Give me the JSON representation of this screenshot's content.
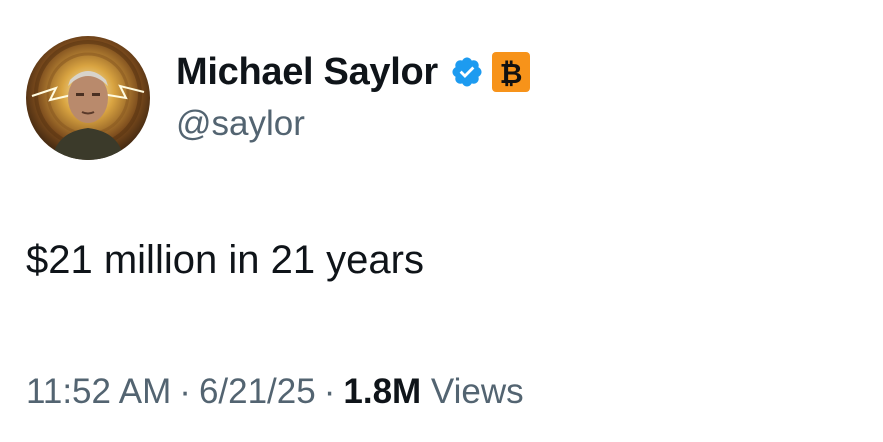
{
  "author": {
    "display_name": "Michael Saylor",
    "handle": "@saylor",
    "verified_icon": "verified-badge-icon",
    "affiliate_icon": "bitcoin-icon",
    "colors": {
      "verified_blue": "#1d9bf0",
      "bitcoin_orange": "#f7931a"
    }
  },
  "tweet": {
    "text": "$21 million in 21 years",
    "time": "11:52 AM",
    "date": "6/21/25",
    "separator": "·",
    "views_count": "1.8M",
    "views_label": "Views"
  }
}
